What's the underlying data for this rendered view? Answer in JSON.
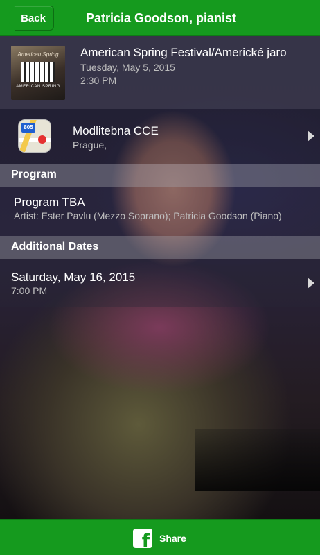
{
  "nav": {
    "back_label": "Back",
    "title": "Patricia Goodson, pianist"
  },
  "event": {
    "thumb_caption": "American Spring",
    "thumb_subcaption": "AMERICAN SPRING",
    "title": "American Spring Festival/Americké jaro",
    "date": "Tuesday, May 5, 2015",
    "time": "2:30 PM"
  },
  "venue": {
    "map_shield": "805",
    "name": "Modlitebna CCE",
    "city": "Prague,"
  },
  "program": {
    "header": "Program",
    "title": "Program TBA",
    "artist": "Artist: Ester Pavlu (Mezzo Soprano); Patricia Goodson (Piano)"
  },
  "additional_dates": {
    "header": "Additional Dates",
    "items": [
      {
        "date": "Saturday, May 16, 2015",
        "time": "7:00 PM"
      }
    ]
  },
  "footer": {
    "share_icon": "facebook-icon",
    "share_label": "Share"
  },
  "colors": {
    "accent": "#159a1e"
  }
}
